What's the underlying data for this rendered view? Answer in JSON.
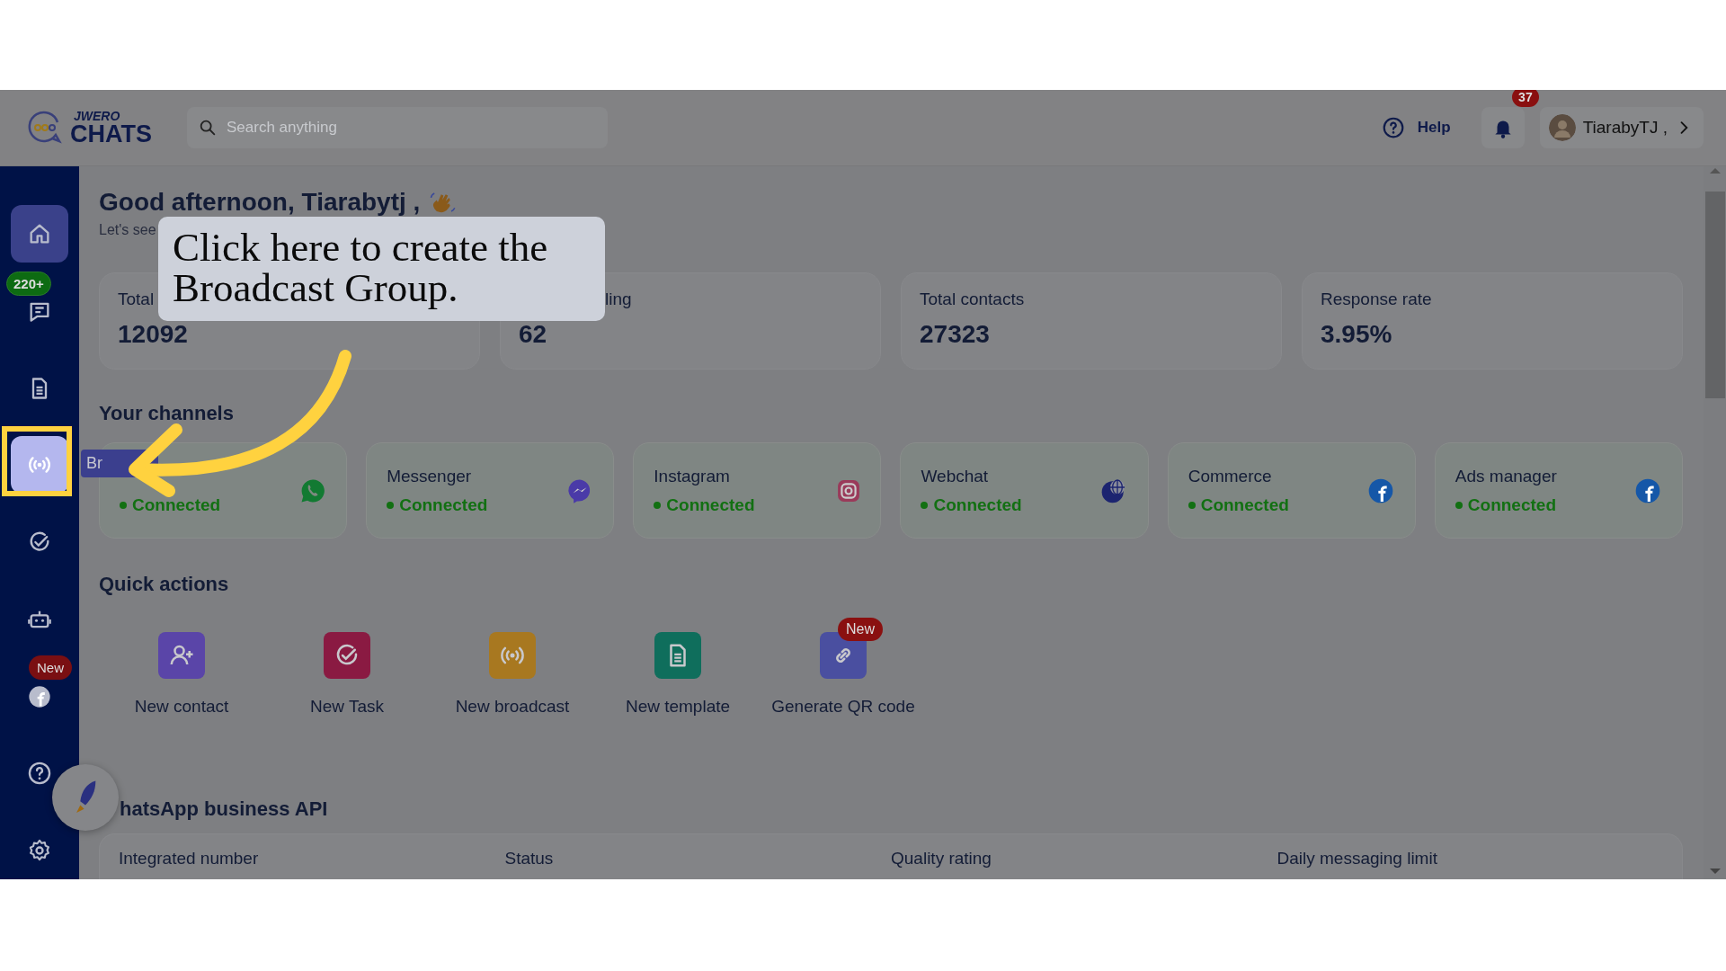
{
  "header": {
    "logo_top": "JWERO",
    "logo_bottom": "CHATS",
    "search_placeholder": "Search anything",
    "help": "Help",
    "notifications": "37",
    "user": "TiarabyTJ ,"
  },
  "sidebar": {
    "items": [
      {
        "kind": "home",
        "selected": true,
        "hovered": false
      },
      {
        "kind": "chat",
        "selected": false,
        "hovered": false,
        "badge": "220+"
      },
      {
        "kind": "document",
        "selected": false,
        "hovered": false
      },
      {
        "kind": "broadcast",
        "selected": false,
        "hovered": true
      },
      {
        "kind": "check",
        "selected": false,
        "hovered": false
      },
      {
        "kind": "bot",
        "selected": false,
        "hovered": false
      },
      {
        "kind": "facebook",
        "selected": false,
        "hovered": false,
        "badge": "New"
      },
      {
        "kind": "help",
        "selected": false,
        "hovered": false
      },
      {
        "kind": "settings",
        "selected": false,
        "hovered": false
      }
    ],
    "hover_tooltip": "Br"
  },
  "greeting": "Good afternoon, Tiarabytj ,",
  "subtitle": "Let's see",
  "stats": [
    {
      "label": "Total",
      "value": "12092"
    },
    {
      "label": "ling",
      "value": "62"
    },
    {
      "label": "Total contacts",
      "value": "27323"
    },
    {
      "label": "Response rate",
      "value": "3.95%"
    }
  ],
  "channels_title": "Your channels",
  "channels": [
    {
      "kind": "whatsapp",
      "status": "Connected"
    },
    {
      "kind": "messenger",
      "name": "Messenger",
      "status": "Connected"
    },
    {
      "kind": "instagram",
      "name": "Instagram",
      "status": "Connected"
    },
    {
      "kind": "webchat",
      "name": "Webchat",
      "status": "Connected"
    },
    {
      "kind": "facebook",
      "name": "Commerce",
      "status": "Connected"
    },
    {
      "kind": "facebook",
      "name": "Ads manager",
      "status": "Connected"
    }
  ],
  "quick_actions_title": "Quick actions",
  "quick_actions": [
    {
      "kind": "contact",
      "label": "New contact",
      "color": "#5a45a8"
    },
    {
      "kind": "task",
      "label": "New Task",
      "color": "#8a1a42"
    },
    {
      "kind": "broadcast",
      "label": "New broadcast",
      "color": "#a87820"
    },
    {
      "kind": "template",
      "label": "New template",
      "color": "#0f6e5c"
    },
    {
      "kind": "qr",
      "label": "Generate QR code",
      "color": "#4a4fa0",
      "badge": "New"
    }
  ],
  "api_title": "hatsApp business API",
  "api_columns": [
    "Integrated number",
    "Status",
    "Quality rating",
    "Daily messaging limit"
  ],
  "callout": "Click here to create the Broadcast Group."
}
